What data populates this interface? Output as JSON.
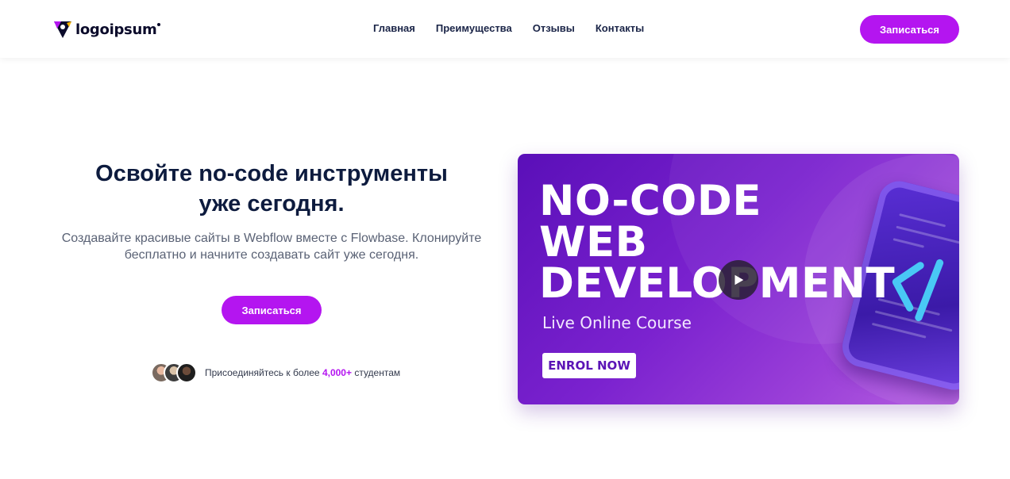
{
  "brand": {
    "name": "logoipsum"
  },
  "nav": {
    "items": [
      {
        "label": "Главная"
      },
      {
        "label": "Преимущества"
      },
      {
        "label": "Отзывы"
      },
      {
        "label": "Контакты"
      }
    ],
    "cta_label": "Записаться"
  },
  "hero": {
    "title_line1": "Освойте no-code инструменты",
    "title_line2": "уже сегодня.",
    "subtitle_line1": "Создавайте красивые сайты в Webflow вместе с Flowbase. Клонируйте",
    "subtitle_line2": "бесплатно и начните создавать сайт уже сегодня.",
    "cta_label": "Записаться",
    "students": {
      "prefix": "Присоединяйтесь к более ",
      "count": "4,000+",
      "suffix": " студентам"
    }
  },
  "video": {
    "title_lines": [
      "NO-CODE",
      "WEB",
      "DEVELOPMENT"
    ],
    "subtitle": "Live Online Course",
    "button_label": "ENROL NOW",
    "icon": "play-icon"
  },
  "colors": {
    "accent": "#b415f0",
    "heading": "#0d1b3e",
    "video_gradient_start": "#5a0fb8",
    "video_gradient_end": "#b45ee0"
  }
}
